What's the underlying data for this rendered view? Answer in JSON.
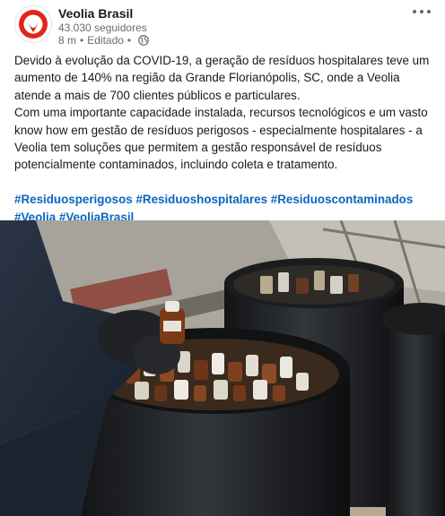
{
  "post": {
    "author": "Veolia Brasil",
    "followers": "43.030 seguidores",
    "time": "8 m",
    "edited": "Editado",
    "logo_icon": "veolia-logo",
    "more_icon": "ellipsis-icon",
    "visibility_icon": "globe-icon",
    "paragraph_1": "Devido à evolução da COVID-19, a geração de resíduos hospitalares teve um aumento de 140% na região da Grande Florianópolis, SC, onde a Veolia atende a mais de 700 clientes públicos e particulares.",
    "paragraph_2": "Com uma importante capacidade instalada, recursos tecnológicos e um vasto know how em gestão de resíduos perigosos - especialmente hospitalares - a Veolia tem soluções que permitem a gestão responsável de resíduos potencialmente contaminados, incluindo coleta e tratamento.",
    "hashtags": [
      "#Residuosperigosos",
      "#Residuoshospitalares",
      "#Residuoscontaminados",
      "#Veolia",
      "#VeoliaBrasil"
    ]
  },
  "colors": {
    "brand_red": "#e1251b",
    "link_blue": "#0a66c2",
    "secondary_text": "#666666"
  }
}
